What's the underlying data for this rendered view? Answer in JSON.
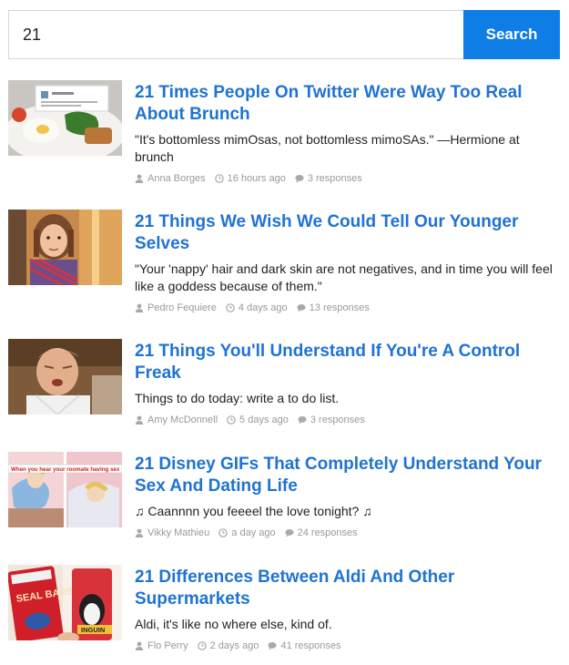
{
  "search": {
    "query": "21",
    "button_label": "Search"
  },
  "results": [
    {
      "title": "21 Times People On Twitter Were Way Too Real About Brunch",
      "description": "\"It's bottomless mimOsas, not bottomless mimoSAs.\" —Hermione at brunch",
      "author": "Anna Borges",
      "time": "16 hours ago",
      "responses": "3 responses"
    },
    {
      "title": "21 Things We Wish We Could Tell Our Younger Selves",
      "description": "\"Your 'nappy' hair and dark skin are not negatives, and in time you will feel like a goddess because of them.\"",
      "author": "Pedro Fequiere",
      "time": "4 days ago",
      "responses": "13 responses"
    },
    {
      "title": "21 Things You'll Understand If You're A Control Freak",
      "description": "Things to do today: write a to do list.",
      "author": "Amy McDonnell",
      "time": "5 days ago",
      "responses": "3 responses"
    },
    {
      "title": "21 Disney GIFs That Completely Understand Your Sex And Dating Life",
      "description": "♫ Caannnn you feeeel the love tonight? ♫",
      "author": "Vikky Mathieu",
      "time": "a day ago",
      "responses": "24 responses",
      "thumb_caption": "When you hear your roomate having sex"
    },
    {
      "title": "21 Differences Between Aldi And Other Supermarkets",
      "description": "Aldi, it's like no where else, kind of.",
      "author": "Flo Perry",
      "time": "2 days ago",
      "responses": "41 responses",
      "thumb_text_1": "SEAL BARS",
      "thumb_text_2": "INGUIN"
    }
  ],
  "colors": {
    "accent": "#1f73d3",
    "button": "#0f7de6",
    "meta": "#9a9a9a"
  }
}
